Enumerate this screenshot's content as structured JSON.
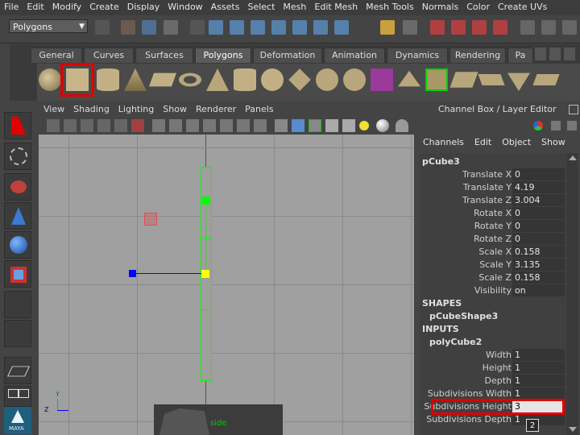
{
  "menu": [
    "File",
    "Edit",
    "Modify",
    "Create",
    "Display",
    "Window",
    "Assets",
    "Select",
    "Mesh",
    "Edit Mesh",
    "Mesh Tools",
    "Normals",
    "Color",
    "Create UVs"
  ],
  "status": {
    "mode": "Polygons"
  },
  "shelf": {
    "tabs": [
      "General",
      "Curves",
      "Surfaces",
      "Polygons",
      "Deformation",
      "Animation",
      "Dynamics",
      "Rendering",
      "Pa"
    ],
    "active_tab": "Polygons"
  },
  "viewport": {
    "menu": [
      "View",
      "Shading",
      "Lighting",
      "Show",
      "Renderer",
      "Panels"
    ],
    "camera_label": "side",
    "axis_y": "Y",
    "axis_z": "Z"
  },
  "channelbox": {
    "title": "Channel Box / Layer Editor",
    "menu": [
      "Channels",
      "Edit",
      "Object",
      "Show"
    ],
    "object": "pCube3",
    "transform": [
      {
        "label": "Translate X",
        "value": "0"
      },
      {
        "label": "Translate Y",
        "value": "4.19"
      },
      {
        "label": "Translate Z",
        "value": "3.004"
      },
      {
        "label": "Rotate X",
        "value": "0"
      },
      {
        "label": "Rotate Y",
        "value": "0"
      },
      {
        "label": "Rotate Z",
        "value": "0"
      },
      {
        "label": "Scale X",
        "value": "0.158"
      },
      {
        "label": "Scale Y",
        "value": "3.135"
      },
      {
        "label": "Scale Z",
        "value": "0.158"
      },
      {
        "label": "Visibility",
        "value": "on"
      }
    ],
    "shapes_header": "SHAPES",
    "shape_name": "pCubeShape3",
    "inputs_header": "INPUTS",
    "input_name": "polyCube2",
    "inputs": [
      {
        "label": "Width",
        "value": "1"
      },
      {
        "label": "Height",
        "value": "1"
      },
      {
        "label": "Depth",
        "value": "1"
      },
      {
        "label": "Subdivisions Width",
        "value": "1"
      },
      {
        "label": "Subdivisions Height",
        "value": "3"
      },
      {
        "label": "Subdivisions Depth",
        "value": "1"
      }
    ],
    "tooltip": "2"
  },
  "toolbox": {
    "logo_text": "MAYA"
  },
  "colors": {
    "highlight": "#e00000",
    "accent": "#00ff00",
    "selection": "#ffff00",
    "axis_blue": "#0000ff"
  }
}
